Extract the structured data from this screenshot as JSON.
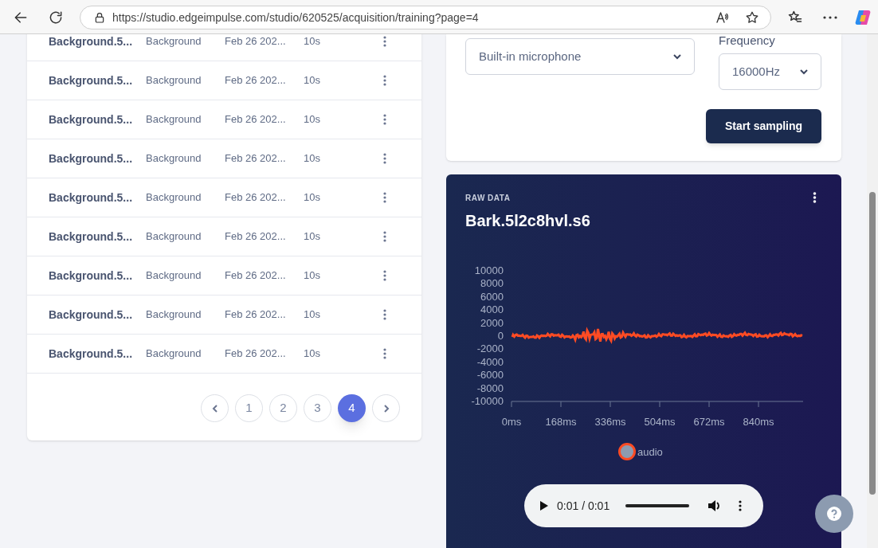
{
  "browser": {
    "url": "https://studio.edgeimpulse.com/studio/620525/acquisition/training?page=4"
  },
  "samples": {
    "rows": [
      {
        "name": "Background.5...",
        "label": "Background",
        "date": "Feb 26 202...",
        "length": "10s"
      },
      {
        "name": "Background.5...",
        "label": "Background",
        "date": "Feb 26 202...",
        "length": "10s"
      },
      {
        "name": "Background.5...",
        "label": "Background",
        "date": "Feb 26 202...",
        "length": "10s"
      },
      {
        "name": "Background.5...",
        "label": "Background",
        "date": "Feb 26 202...",
        "length": "10s"
      },
      {
        "name": "Background.5...",
        "label": "Background",
        "date": "Feb 26 202...",
        "length": "10s"
      },
      {
        "name": "Background.5...",
        "label": "Background",
        "date": "Feb 26 202...",
        "length": "10s"
      },
      {
        "name": "Background.5...",
        "label": "Background",
        "date": "Feb 26 202...",
        "length": "10s"
      },
      {
        "name": "Background.5...",
        "label": "Background",
        "date": "Feb 26 202...",
        "length": "10s"
      },
      {
        "name": "Background.5...",
        "label": "Background",
        "date": "Feb 26 202...",
        "length": "10s"
      }
    ],
    "pagination": [
      {
        "kind": "prev"
      },
      {
        "kind": "page",
        "label": "1",
        "selected": false
      },
      {
        "kind": "page",
        "label": "2",
        "selected": false
      },
      {
        "kind": "page",
        "label": "3",
        "selected": false
      },
      {
        "kind": "page",
        "label": "4",
        "selected": true
      },
      {
        "kind": "next"
      }
    ]
  },
  "collect": {
    "device": "Built-in microphone",
    "frequency_label": "Frequency",
    "frequency": "16000Hz",
    "button": "Start sampling"
  },
  "raw_data": {
    "heading": "RAW DATA",
    "title": "Bark.5l2c8hvl.s6",
    "y_ticks": [
      "10000",
      "8000",
      "6000",
      "4000",
      "2000",
      "0",
      "-2000",
      "-4000",
      "-6000",
      "-8000",
      "-10000"
    ],
    "x_ticks": [
      "0ms",
      "168ms",
      "336ms",
      "504ms",
      "672ms",
      "840ms"
    ],
    "legend": {
      "label": "audio",
      "color": "#ff4b23"
    },
    "player": {
      "time": "0:01 / 0:01",
      "level": 1
    }
  }
}
